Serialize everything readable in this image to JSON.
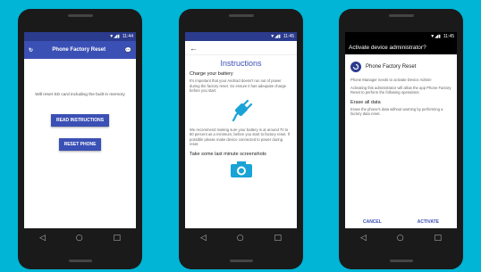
{
  "phone1": {
    "status_time": "11:44",
    "app_title": "Phone Factory Reset",
    "message": "Will reset SD card including the built in memory",
    "read_button": "READ INSTRUCTIONS",
    "reset_button": "RESET PHONE"
  },
  "phone2": {
    "status_time": "11:45",
    "back_glyph": "←",
    "title": "Instructions",
    "heading1": "Charge your battery",
    "para1": "It's important that your Android doesn't run out of power during the factory reset. So ensure it has adequate charge before you start.",
    "para2": "We recommend making sure your battery is at around 70 to 80 percent as a minimum, before you start to factory reset. If possible please make device connected to power during reset.",
    "heading2": "Take some last minute screenshots"
  },
  "phone3": {
    "status_time": "11:45",
    "appbar_title": "Activate device administrator?",
    "app_name": "Phone Factory Reset",
    "para1": "Phone Manager needs to activate Device Admin!",
    "para2": "Activating this administrator will allow the app Phone Factory Reset to perform the following operations:",
    "heading": "Erase all data",
    "para3": "Erase the phone's data without warning by performing a factory data reset.",
    "cancel": "CANCEL",
    "activate": "ACTIVATE"
  },
  "nav": {
    "back": "◁",
    "home": "○",
    "recents": "□"
  },
  "colors": {
    "background": "#00b5d6",
    "primary": "#3b50b5",
    "statusbar": "#2b3b8e"
  }
}
